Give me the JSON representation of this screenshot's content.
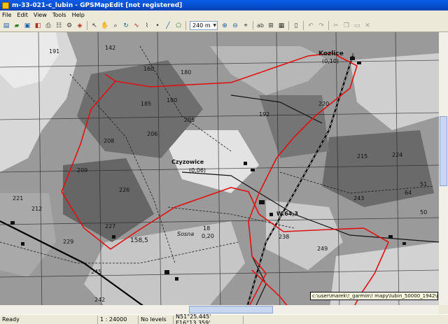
{
  "window": {
    "title": "m-33-021-c_lubin - GPSMapEdit [not registered]"
  },
  "menu": [
    "File",
    "Edit",
    "View",
    "Tools",
    "Help"
  ],
  "toolbar": {
    "icons_left": [
      "new-icon",
      "open-icon",
      "save-icon",
      "export-icon",
      "print-icon",
      "properties-icon",
      "settings-icon",
      "map-icon"
    ],
    "tools": [
      "select-icon",
      "hand-icon",
      "zoom-icon",
      "rotate-icon",
      "trace-icon",
      "edit-node-icon",
      "point-icon",
      "line-icon",
      "polygon-icon"
    ],
    "scale": "240 m",
    "icons_right": [
      "zoom-in-icon",
      "zoom-out-icon",
      "zoom-fit-icon",
      "labels-icon",
      "grid-icon",
      "levels-icon",
      "lock-icon",
      "undo-icon",
      "redo-icon",
      "cut-icon",
      "copy-icon",
      "paste-icon",
      "delete-icon"
    ]
  },
  "map": {
    "labels": [
      "Kozlice",
      "(0,10)",
      "Czyzowice",
      "(0,06)",
      "220",
      "205",
      "206",
      "208",
      "209",
      "226",
      "227",
      "158,5",
      "185",
      "160",
      "180",
      "212",
      "229",
      "224",
      "249",
      "243",
      "215",
      "142",
      "191",
      "180",
      "192",
      "245",
      "242",
      "221",
      "238",
      "51",
      "50",
      "64",
      "W.64,3",
      "Sosna",
      "18",
      "0,20"
    ],
    "tooltip": "c:\\user\\marek\\!_garmin\\! mapy\\lubin_50000_1942\\m-33-021-c_lubin"
  },
  "status": {
    "state": "Ready",
    "scale": "1 : 24000",
    "levels": "No levels",
    "coords": "N51°25.445' E16°13.359'"
  }
}
